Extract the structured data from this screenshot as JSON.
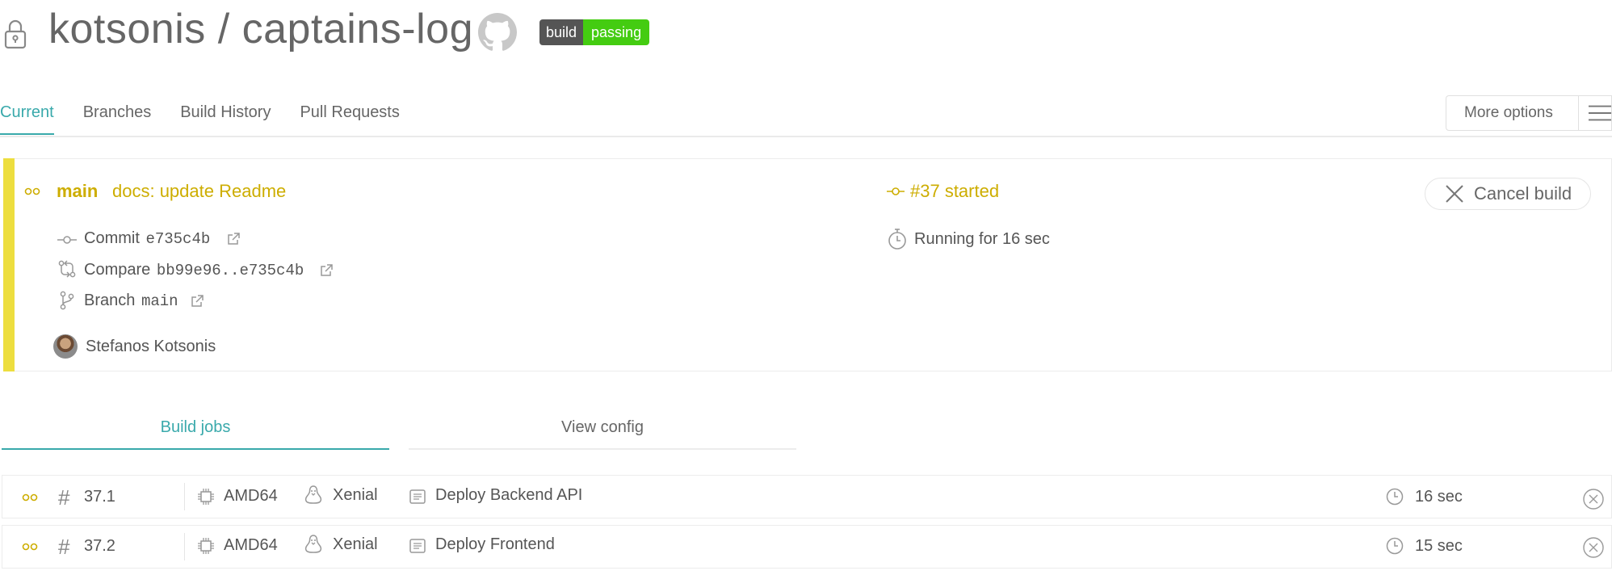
{
  "header": {
    "repo_title": "kotsonis / captains-log",
    "badge_left": "build",
    "badge_right": "passing"
  },
  "tabs": [
    {
      "label": "Current",
      "active": true
    },
    {
      "label": "Branches"
    },
    {
      "label": "Build History"
    },
    {
      "label": "Pull Requests"
    }
  ],
  "more_options": {
    "label": "More options"
  },
  "build": {
    "branch": "main",
    "message": "docs: update Readme",
    "number_status": "#37 started",
    "commit_label": "Commit",
    "commit_hash": "e735c4b",
    "compare_label": "Compare",
    "compare_range": "bb99e96..e735c4b",
    "branch_label": "Branch",
    "branch_name": "main",
    "running": "Running for 16 sec",
    "author": "Stefanos Kotsonis",
    "cancel_label": "Cancel build",
    "status_color": "#edde3f"
  },
  "subtabs": {
    "jobs": "Build jobs",
    "config": "View config"
  },
  "jobs": [
    {
      "number": "37.1",
      "arch": "AMD64",
      "os": "Xenial",
      "name": "Deploy Backend API",
      "duration": "16 sec"
    },
    {
      "number": "37.2",
      "arch": "AMD64",
      "os": "Xenial",
      "name": "Deploy Frontend",
      "duration": "15 sec"
    }
  ],
  "colors": {
    "accent": "#39a9ab",
    "running": "#cdad00",
    "badge_pass": "#44cc11"
  }
}
